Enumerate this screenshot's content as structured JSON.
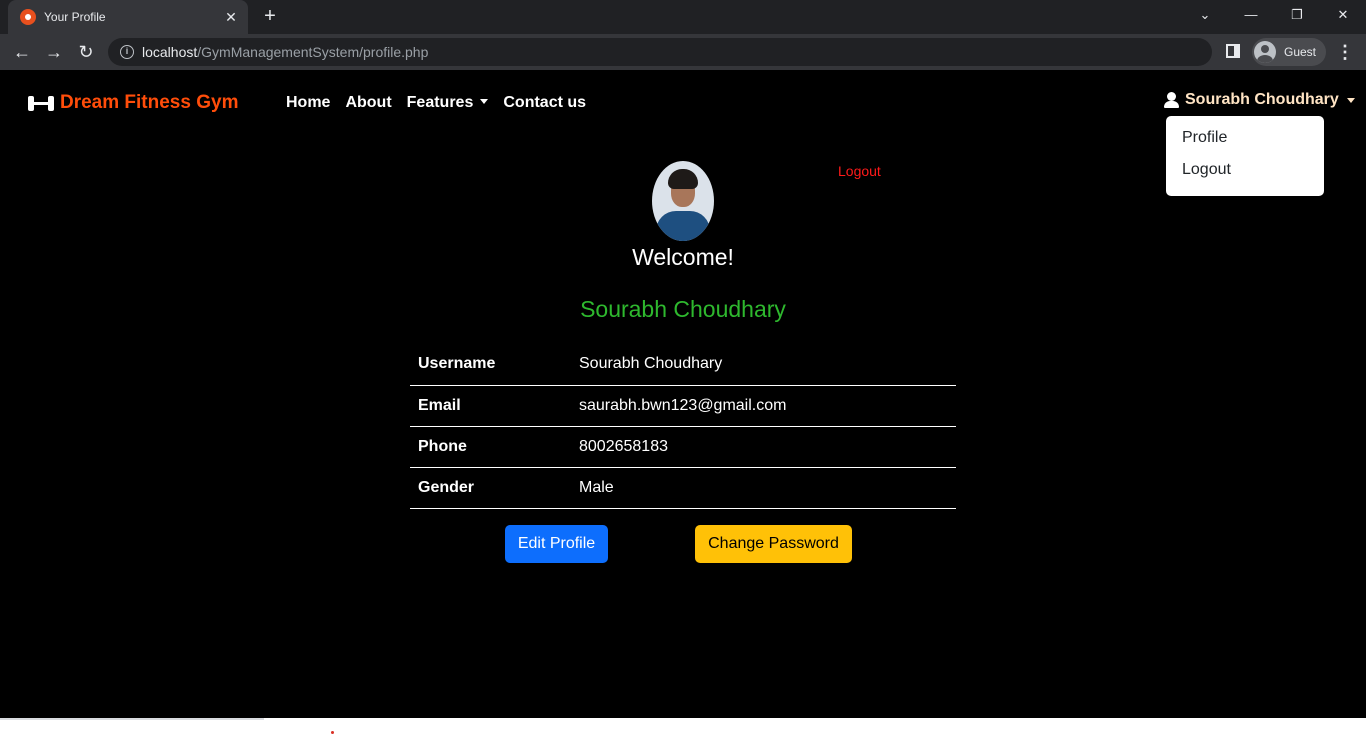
{
  "browser": {
    "tab_title": "Your Profile",
    "url_host": "localhost",
    "url_path": "/GymManagementSystem/profile.php",
    "profile_label": "Guest"
  },
  "navbar": {
    "brand": "Dream Fitness Gym",
    "links": [
      "Home",
      "About",
      "Features",
      "Contact us"
    ],
    "user_name": "Sourabh Choudhary",
    "dropdown": [
      "Profile",
      "Logout"
    ]
  },
  "profile": {
    "logout_label": "Logout",
    "welcome": "Welcome!",
    "full_name": "Sourabh Choudhary",
    "fields": [
      {
        "label": "Username",
        "value": "Sourabh Choudhary"
      },
      {
        "label": "Email",
        "value": "saurabh.bwn123@gmail.com"
      },
      {
        "label": "Phone",
        "value": "8002658183"
      },
      {
        "label": "Gender",
        "value": "Male"
      }
    ],
    "edit_button": "Edit Profile",
    "password_button": "Change Password"
  },
  "colors": {
    "brand": "#ff4d0a",
    "name_green": "#2eb82e",
    "edit_blue": "#0d6efd",
    "password_yellow": "#ffc107",
    "logout_red": "#ff1a1a"
  }
}
